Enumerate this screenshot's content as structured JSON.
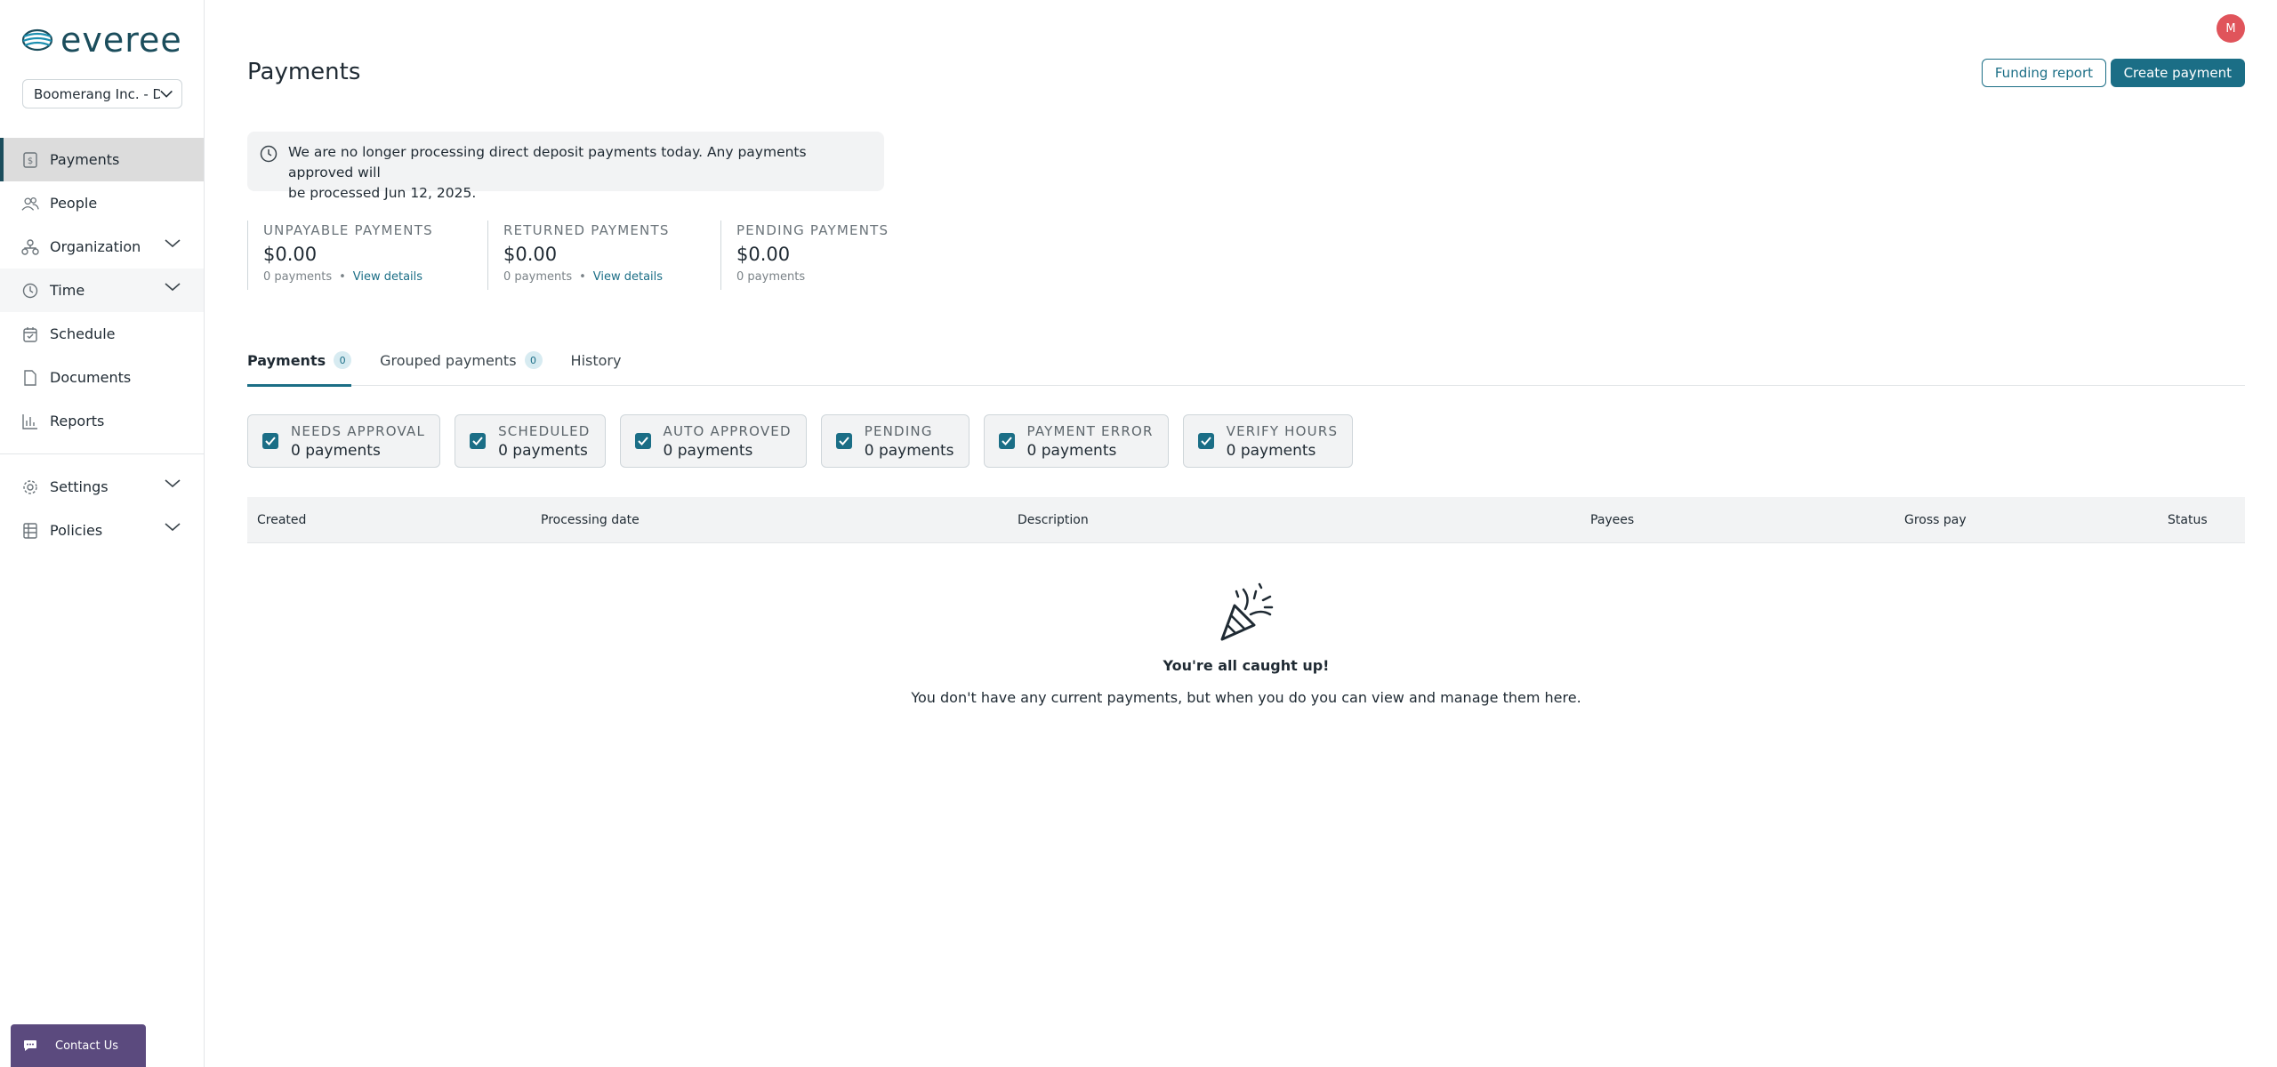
{
  "brand": {
    "name": "everee",
    "color": "#1b4d5c",
    "accent": "#1b6e86"
  },
  "company_select": {
    "value": "Boomerang Inc. - D..."
  },
  "nav": {
    "items": [
      {
        "label": "Payments",
        "icon": "dollar-doc-icon"
      },
      {
        "label": "People",
        "icon": "people-icon"
      },
      {
        "label": "Organization",
        "icon": "org-chart-icon"
      },
      {
        "label": "Time",
        "icon": "clock-icon"
      },
      {
        "label": "Schedule",
        "icon": "calendar-icon"
      },
      {
        "label": "Documents",
        "icon": "document-icon"
      },
      {
        "label": "Reports",
        "icon": "bar-chart-icon"
      },
      {
        "label": "Settings",
        "icon": "gear-icon"
      },
      {
        "label": "Policies",
        "icon": "grid-icon"
      }
    ]
  },
  "contact": {
    "label": "Contact Us",
    "color": "#5b4a7e"
  },
  "user": {
    "initial": "M",
    "color": "#e0545b"
  },
  "page": {
    "title": "Payments",
    "funding_report_label": "Funding report",
    "create_payment_label": "Create payment"
  },
  "notice": {
    "line1": "We are no longer processing direct deposit payments today. Any payments approved will",
    "line2": "be processed Jun 12, 2025."
  },
  "summary": [
    {
      "title": "Unpayable payments",
      "amount": "$0.00",
      "count": "0 payments",
      "link": "View details"
    },
    {
      "title": "Returned payments",
      "amount": "$0.00",
      "count": "0 payments",
      "link": "View details"
    },
    {
      "title": "Pending payments",
      "amount": "$0.00",
      "count": "0 payments"
    }
  ],
  "tabs": [
    {
      "label": "Payments",
      "badge": "0"
    },
    {
      "label": "Grouped payments",
      "badge": "0"
    },
    {
      "label": "History"
    }
  ],
  "filters": [
    {
      "title": "Needs approval",
      "count": "0 payments"
    },
    {
      "title": "Scheduled",
      "count": "0 payments"
    },
    {
      "title": "Auto approved",
      "count": "0 payments"
    },
    {
      "title": "Pending",
      "count": "0 payments"
    },
    {
      "title": "Payment error",
      "count": "0 payments"
    },
    {
      "title": "Verify hours",
      "count": "0 payments"
    }
  ],
  "table": {
    "columns": [
      "Created",
      "Processing date",
      "Description",
      "Payees",
      "Gross pay",
      "Status"
    ]
  },
  "empty_state": {
    "icon": "party-popper-icon",
    "title": "You're all caught up!",
    "message": "You don't have any current payments, but when you do you can view and manage them here."
  }
}
